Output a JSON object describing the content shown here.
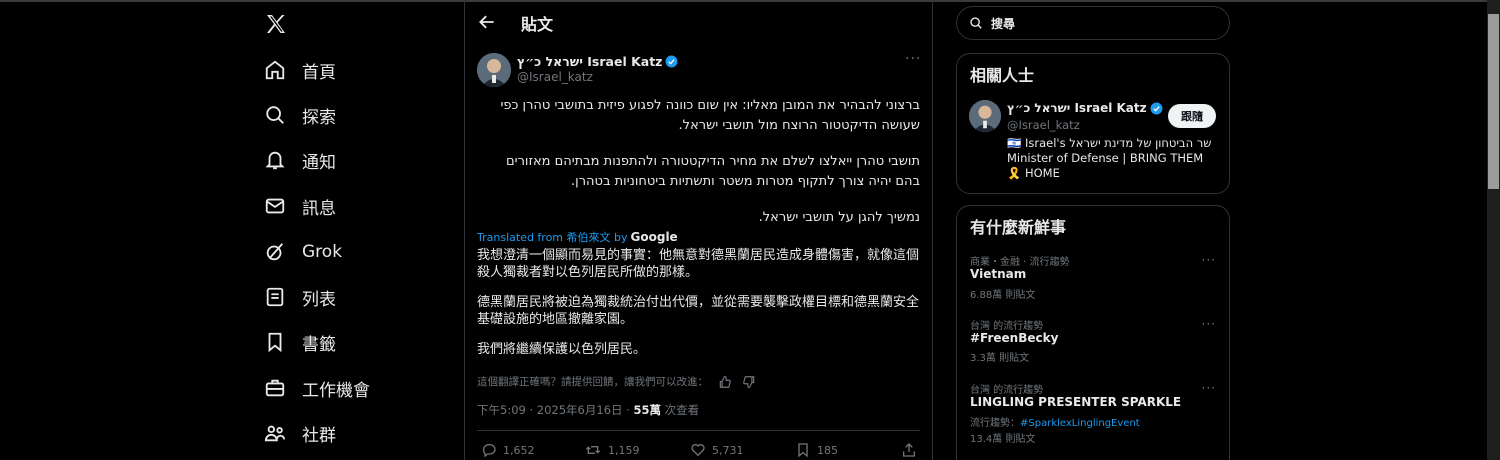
{
  "colors": {
    "accent": "#1d9bf0",
    "background": "#000000",
    "text": "#e7e9ea",
    "muted": "#71767b",
    "border": "#2f3336"
  },
  "nav": {
    "logo": "x-logo-icon",
    "items": [
      {
        "label": "首頁",
        "icon": "home-icon"
      },
      {
        "label": "探索",
        "icon": "search-icon"
      },
      {
        "label": "通知",
        "icon": "bell-icon"
      },
      {
        "label": "訊息",
        "icon": "mail-icon"
      },
      {
        "label": "Grok",
        "icon": "grok-icon"
      },
      {
        "label": "列表",
        "icon": "list-icon"
      },
      {
        "label": "書籤",
        "icon": "bookmark-icon"
      },
      {
        "label": "工作機會",
        "icon": "briefcase-icon"
      },
      {
        "label": "社群",
        "icon": "people-icon"
      }
    ]
  },
  "header": {
    "title": "貼文"
  },
  "post": {
    "author_name": "ישראל כ״ץ Israel Katz",
    "author_handle": "@Israel_katz",
    "hebrew_paragraphs": [
      "ברצוני להבהיר את המובן מאליו: אין שום כוונה לפגוע פיזית בתושבי טהרן כפי שעושה הדיקטטור הרוצח מול תושבי ישראל.",
      "תושבי טהרן ייאלצו לשלם את מחיר הדיקטטורה ולהתפנות מבתיהם מאזורים בהם יהיה צורך לתקוף מטרות משטר ותשתיות ביטחוניות בטהרן.",
      "נמשיך להגן על תושבי ישראל."
    ],
    "translated_from": "Translated from 希伯來文 by",
    "translated_by": "Google",
    "translation_paragraphs": [
      "我想澄清一個顯而易見的事實：他無意對德黑蘭居民造成身體傷害，就像這個殺人獨裁者對以色列居民所做的那樣。",
      "德黑蘭居民將被迫為獨裁統治付出代價，並從需要襲擊政權目標和德黑蘭安全基礎設施的地區撤離家園。",
      "我們將繼續保護以色列居民。"
    ],
    "feedback_text": "這個翻譯正確嗎？請提供回饋，讓我們可以改進：",
    "time": "下午5:09 · 2025年6月16日 ·",
    "views_count": "55萬",
    "views_label": "次查看",
    "actions": {
      "replies": "1,652",
      "reposts": "1,159",
      "likes": "5,731",
      "bookmarks": "185"
    }
  },
  "search": {
    "placeholder": "搜尋"
  },
  "related": {
    "title": "相關人士",
    "name": "ישראל כ״ץ Israel Katz",
    "handle": "@Israel_katz",
    "follow_label": "跟隨",
    "bio_line1": "שר הביטחון של מדינת ישראל 🇮🇱 Israel's",
    "bio_line2": "Minister of Defense | BRING THEM",
    "bio_line3": "🎗️ HOME"
  },
  "trends": {
    "title": "有什麼新鮮事",
    "items": [
      {
        "context": "商業・金融 · 流行趨勢",
        "name": "Vietnam",
        "count": "6.88萬 則貼文"
      },
      {
        "context": "台灣 的流行趨勢",
        "name": "#FreenBecky",
        "count": "3.3萬 則貼文"
      },
      {
        "context": "台灣 的流行趨勢",
        "name": "LINGLING PRESENTER SPARKLE",
        "sub_prefix": "流行趨勢：",
        "sub_link": "#SparklexLinglingEvent",
        "count": "13.4萬 則貼文"
      }
    ]
  }
}
